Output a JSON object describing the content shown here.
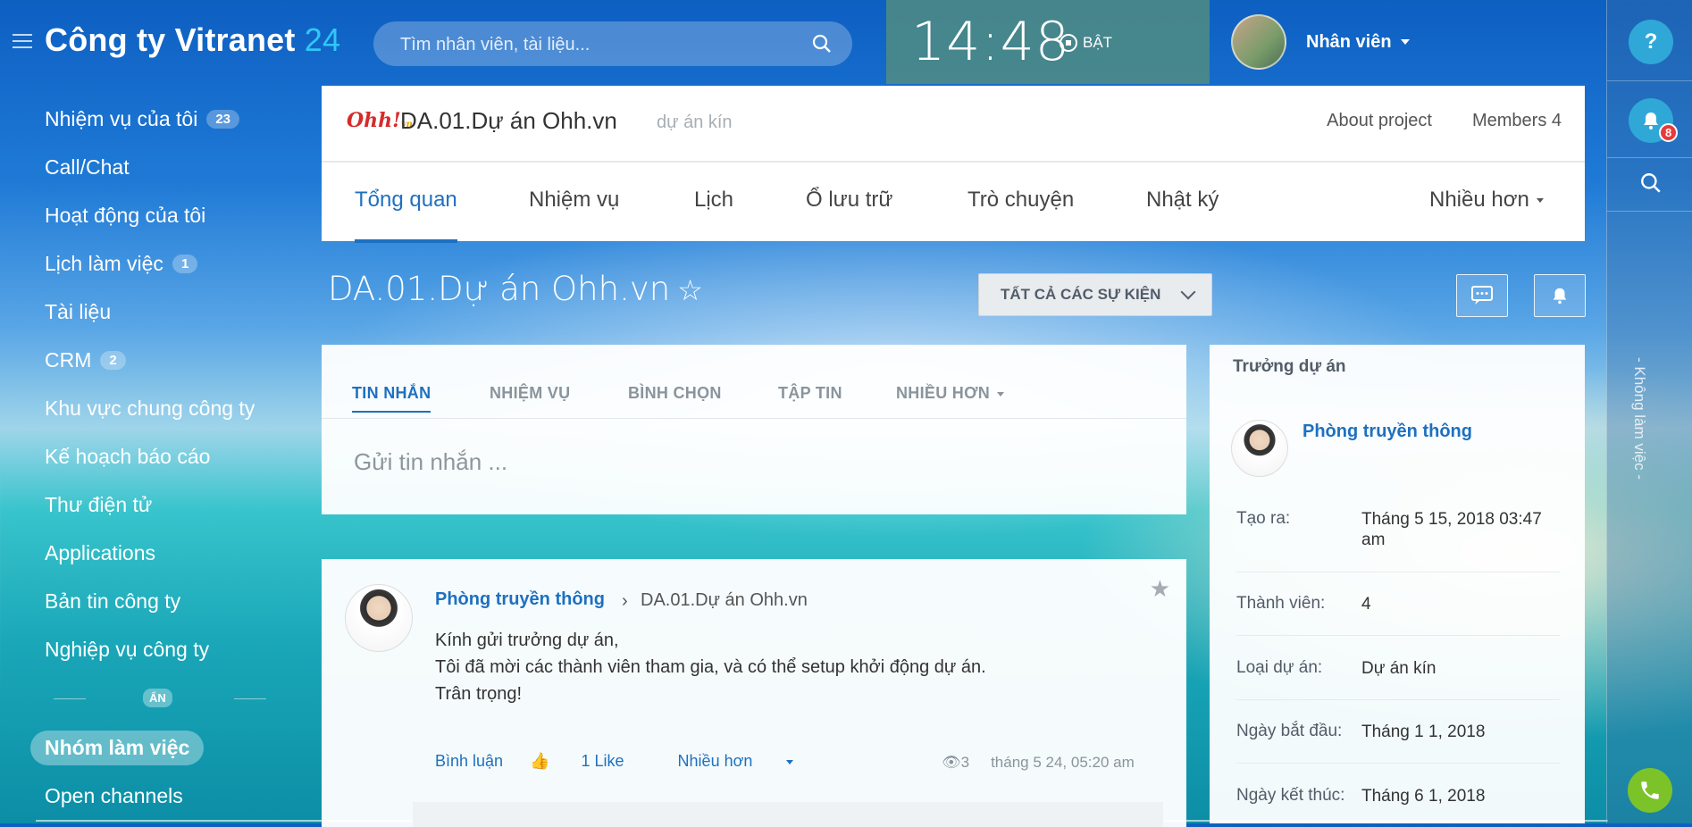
{
  "sidebar": {
    "logo_name": "Công ty Vitranet",
    "logo_num": "24",
    "items": [
      {
        "label": "Nhiệm vụ của tôi",
        "badge": "23"
      },
      {
        "label": "Call/Chat",
        "badge": ""
      },
      {
        "label": "Hoạt động của tôi",
        "badge": ""
      },
      {
        "label": "Lịch làm việc",
        "badge": "1"
      },
      {
        "label": "Tài liệu",
        "badge": ""
      },
      {
        "label": "CRM",
        "badge": "2"
      },
      {
        "label": "Khu vực chung công ty",
        "badge": ""
      },
      {
        "label": "Kế hoạch báo cáo",
        "badge": ""
      },
      {
        "label": "Thư điện tử",
        "badge": ""
      },
      {
        "label": "Applications",
        "badge": ""
      },
      {
        "label": "Bản tin công ty",
        "badge": ""
      },
      {
        "label": "Nghiệp vụ công ty",
        "badge": ""
      }
    ],
    "hide_label": "ẨN",
    "workgroups": "Nhóm làm việc",
    "open_channels": "Open channels"
  },
  "header": {
    "search_placeholder": "Tìm nhân viên, tài liệu...",
    "clock": "14:48",
    "clock_status": "BẬT",
    "user_name": "Nhân viên"
  },
  "rightbar": {
    "help": "?",
    "notif_count": "8",
    "vertical_text": "- Không làm việc -"
  },
  "project": {
    "logo_text": "Ohh!",
    "logo_sub": "vn",
    "title": "DA.01.Dự án Ohh.vn",
    "type": "dự án kín",
    "about": "About project",
    "members": "Members 4",
    "tabs": [
      "Tổng quan",
      "Nhiệm vụ",
      "Lịch",
      "Ổ lưu trữ",
      "Trò chuyện",
      "Nhật ký",
      "Nhiều hơn"
    ]
  },
  "page": {
    "title": "DA.01.Dự án Ohh.vn",
    "star": "☆",
    "events_button": "TẤT CẢ CÁC SỰ KIỆN"
  },
  "composer": {
    "tabs": [
      "TIN NHẮN",
      "NHIỆM VỤ",
      "BÌNH CHỌN",
      "TẬP TIN",
      "NHIỀU HƠN"
    ],
    "placeholder": "Gửi tin nhắn ..."
  },
  "post": {
    "author": "Phòng truyền thông",
    "destination": "DA.01.Dự án Ohh.vn",
    "lines": [
      "Kính gửi trưởng dự án,",
      "Tôi đã mời các thành viên tham gia, và có thể setup khởi động dự án.",
      "Trân trọng!"
    ],
    "comment": "Bình luận",
    "like": "1 Like",
    "more": "Nhiều hơn",
    "views": "3",
    "time": "tháng 5 24, 05:20 am"
  },
  "info": {
    "title": "Trưởng dự án",
    "owner": "Phòng truyền thông",
    "rows": [
      {
        "k": "Tạo ra:",
        "v": "Tháng 5 15, 2018 03:47 am"
      },
      {
        "k": "Thành viên:",
        "v": "4"
      },
      {
        "k": "Loại dự án:",
        "v": "Dự án kín"
      },
      {
        "k": "Ngày bắt đầu:",
        "v": "Tháng 1 1, 2018"
      },
      {
        "k": "Ngày kết thúc:",
        "v": "Tháng 6 1, 2018"
      }
    ]
  },
  "colors": {
    "accent": "#1e70c0",
    "logo_number": "#2fc7f7",
    "notif_badge": "#e83a3a",
    "phone": "#7cc32a"
  },
  "icons": [
    "menu-icon",
    "search-icon",
    "clock-stop-icon",
    "chevron-down-icon",
    "help-icon",
    "bell-icon",
    "chat-icon",
    "star-icon",
    "like-icon",
    "eye-icon",
    "phone-icon"
  ]
}
